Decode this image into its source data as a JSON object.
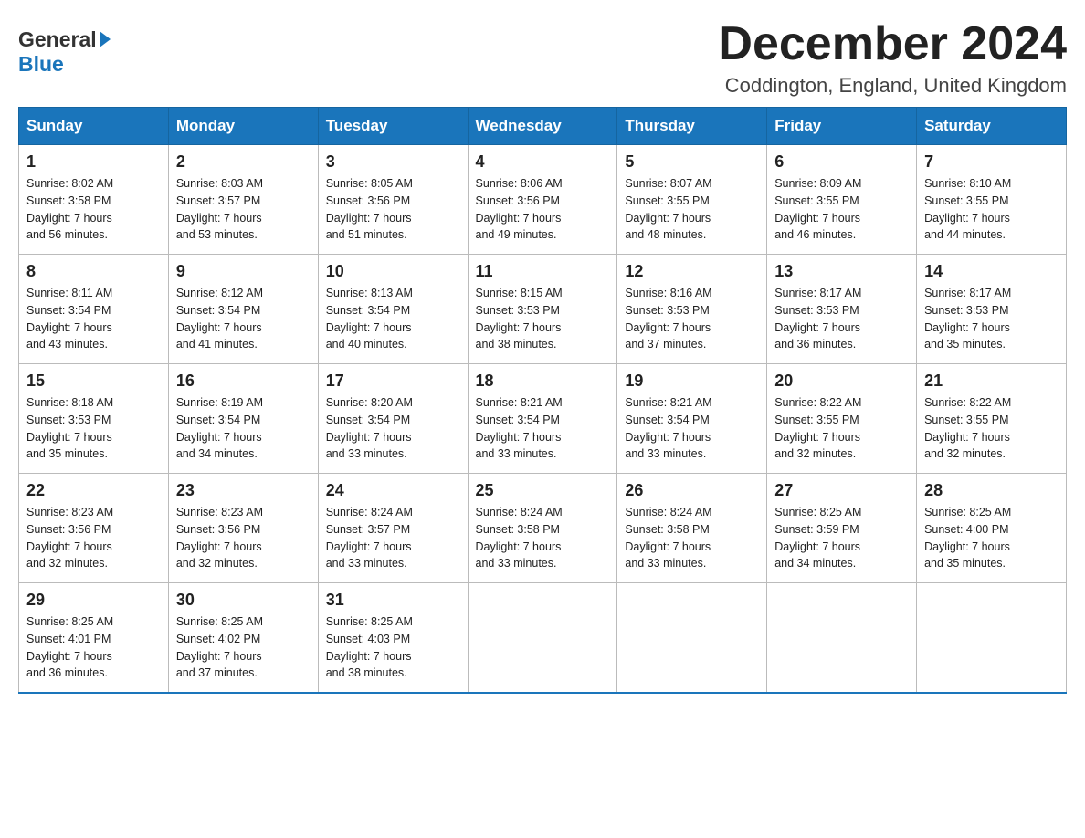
{
  "header": {
    "title": "December 2024",
    "subtitle": "Coddington, England, United Kingdom",
    "logo_general": "General",
    "logo_blue": "Blue"
  },
  "weekdays": [
    "Sunday",
    "Monday",
    "Tuesday",
    "Wednesday",
    "Thursday",
    "Friday",
    "Saturday"
  ],
  "weeks": [
    [
      {
        "day": "1",
        "sunrise": "8:02 AM",
        "sunset": "3:58 PM",
        "daylight": "7 hours and 56 minutes."
      },
      {
        "day": "2",
        "sunrise": "8:03 AM",
        "sunset": "3:57 PM",
        "daylight": "7 hours and 53 minutes."
      },
      {
        "day": "3",
        "sunrise": "8:05 AM",
        "sunset": "3:56 PM",
        "daylight": "7 hours and 51 minutes."
      },
      {
        "day": "4",
        "sunrise": "8:06 AM",
        "sunset": "3:56 PM",
        "daylight": "7 hours and 49 minutes."
      },
      {
        "day": "5",
        "sunrise": "8:07 AM",
        "sunset": "3:55 PM",
        "daylight": "7 hours and 48 minutes."
      },
      {
        "day": "6",
        "sunrise": "8:09 AM",
        "sunset": "3:55 PM",
        "daylight": "7 hours and 46 minutes."
      },
      {
        "day": "7",
        "sunrise": "8:10 AM",
        "sunset": "3:55 PM",
        "daylight": "7 hours and 44 minutes."
      }
    ],
    [
      {
        "day": "8",
        "sunrise": "8:11 AM",
        "sunset": "3:54 PM",
        "daylight": "7 hours and 43 minutes."
      },
      {
        "day": "9",
        "sunrise": "8:12 AM",
        "sunset": "3:54 PM",
        "daylight": "7 hours and 41 minutes."
      },
      {
        "day": "10",
        "sunrise": "8:13 AM",
        "sunset": "3:54 PM",
        "daylight": "7 hours and 40 minutes."
      },
      {
        "day": "11",
        "sunrise": "8:15 AM",
        "sunset": "3:53 PM",
        "daylight": "7 hours and 38 minutes."
      },
      {
        "day": "12",
        "sunrise": "8:16 AM",
        "sunset": "3:53 PM",
        "daylight": "7 hours and 37 minutes."
      },
      {
        "day": "13",
        "sunrise": "8:17 AM",
        "sunset": "3:53 PM",
        "daylight": "7 hours and 36 minutes."
      },
      {
        "day": "14",
        "sunrise": "8:17 AM",
        "sunset": "3:53 PM",
        "daylight": "7 hours and 35 minutes."
      }
    ],
    [
      {
        "day": "15",
        "sunrise": "8:18 AM",
        "sunset": "3:53 PM",
        "daylight": "7 hours and 35 minutes."
      },
      {
        "day": "16",
        "sunrise": "8:19 AM",
        "sunset": "3:54 PM",
        "daylight": "7 hours and 34 minutes."
      },
      {
        "day": "17",
        "sunrise": "8:20 AM",
        "sunset": "3:54 PM",
        "daylight": "7 hours and 33 minutes."
      },
      {
        "day": "18",
        "sunrise": "8:21 AM",
        "sunset": "3:54 PM",
        "daylight": "7 hours and 33 minutes."
      },
      {
        "day": "19",
        "sunrise": "8:21 AM",
        "sunset": "3:54 PM",
        "daylight": "7 hours and 33 minutes."
      },
      {
        "day": "20",
        "sunrise": "8:22 AM",
        "sunset": "3:55 PM",
        "daylight": "7 hours and 32 minutes."
      },
      {
        "day": "21",
        "sunrise": "8:22 AM",
        "sunset": "3:55 PM",
        "daylight": "7 hours and 32 minutes."
      }
    ],
    [
      {
        "day": "22",
        "sunrise": "8:23 AM",
        "sunset": "3:56 PM",
        "daylight": "7 hours and 32 minutes."
      },
      {
        "day": "23",
        "sunrise": "8:23 AM",
        "sunset": "3:56 PM",
        "daylight": "7 hours and 32 minutes."
      },
      {
        "day": "24",
        "sunrise": "8:24 AM",
        "sunset": "3:57 PM",
        "daylight": "7 hours and 33 minutes."
      },
      {
        "day": "25",
        "sunrise": "8:24 AM",
        "sunset": "3:58 PM",
        "daylight": "7 hours and 33 minutes."
      },
      {
        "day": "26",
        "sunrise": "8:24 AM",
        "sunset": "3:58 PM",
        "daylight": "7 hours and 33 minutes."
      },
      {
        "day": "27",
        "sunrise": "8:25 AM",
        "sunset": "3:59 PM",
        "daylight": "7 hours and 34 minutes."
      },
      {
        "day": "28",
        "sunrise": "8:25 AM",
        "sunset": "4:00 PM",
        "daylight": "7 hours and 35 minutes."
      }
    ],
    [
      {
        "day": "29",
        "sunrise": "8:25 AM",
        "sunset": "4:01 PM",
        "daylight": "7 hours and 36 minutes."
      },
      {
        "day": "30",
        "sunrise": "8:25 AM",
        "sunset": "4:02 PM",
        "daylight": "7 hours and 37 minutes."
      },
      {
        "day": "31",
        "sunrise": "8:25 AM",
        "sunset": "4:03 PM",
        "daylight": "7 hours and 38 minutes."
      },
      null,
      null,
      null,
      null
    ]
  ]
}
